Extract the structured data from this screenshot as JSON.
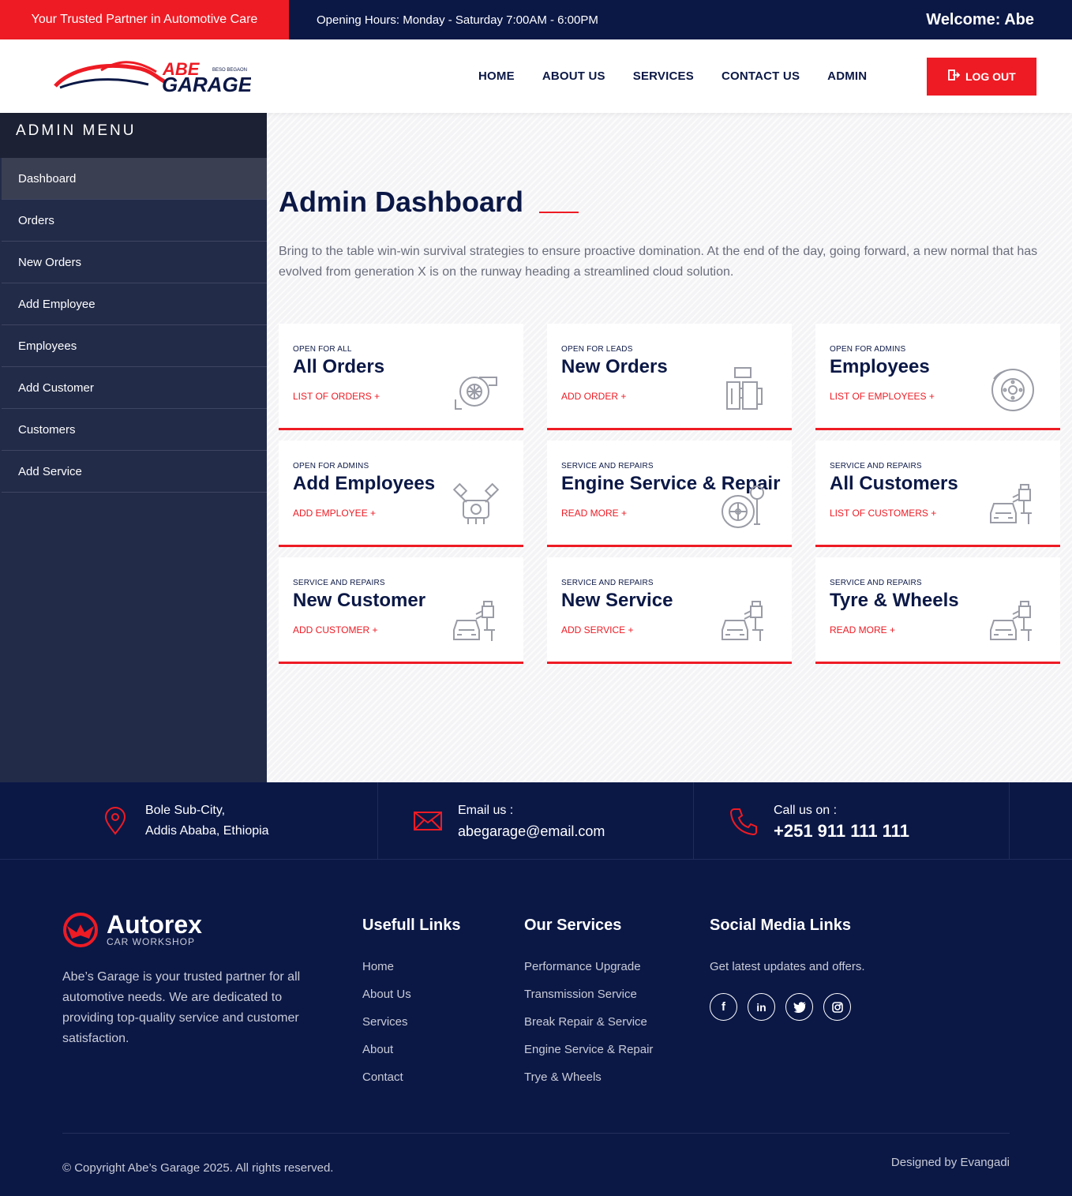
{
  "topbar": {
    "tagline": "Your Trusted Partner in Automotive Care",
    "hours": "Opening Hours: Monday - Saturday 7:00AM - 6:00PM",
    "welcome": "Welcome: Abe"
  },
  "header": {
    "logo_text_top": "ABE",
    "logo_text_bottom": "GARAGE",
    "logo_small": "BESO BEGAON",
    "nav": [
      "HOME",
      "ABOUT US",
      "SERVICES",
      "CONTACT US",
      "ADMIN"
    ],
    "logout_label": "LOG OUT"
  },
  "sidebar": {
    "title": "ADMIN MENU",
    "items": [
      "Dashboard",
      "Orders",
      "New Orders",
      "Add Employee",
      "Employees",
      "Add Customer",
      "Customers",
      "Add Service"
    ],
    "active_index": 0
  },
  "dashboard": {
    "title": "Admin Dashboard",
    "lead": "Bring to the table win-win survival strategies to ensure proactive domination. At the end of the day, going forward, a new normal that has evolved from generation X is on the runway heading a streamlined cloud solution.",
    "cards": [
      {
        "small": "Open for All",
        "heading": "All Orders",
        "link": "LIST OF ORDERS +",
        "icon": "turbo-icon"
      },
      {
        "small": "Open for leads",
        "heading": "New Orders",
        "link": "ADD ORDER +",
        "icon": "gearbox-icon"
      },
      {
        "small": "Open for admins",
        "heading": "Employees",
        "link": "LIST OF EMPLOYEES +",
        "icon": "brake-disc-icon"
      },
      {
        "small": "Open for admins",
        "heading": "Add Employees",
        "link": "ADD EMPLOYEE +",
        "icon": "engine-icon"
      },
      {
        "small": "Service and Repairs",
        "heading": "Engine Service & Repair",
        "link": "READ MORE +",
        "icon": "tyre-gauge-icon"
      },
      {
        "small": "Service and Repairs",
        "heading": "All Customers",
        "link": "LIST OF CUSTOMERS +",
        "icon": "car-paint-icon"
      },
      {
        "small": "Service and Repairs",
        "heading": "New Customer",
        "link": "ADD CUSTOMER +",
        "icon": "car-paint-icon"
      },
      {
        "small": "Service and Repairs",
        "heading": "New Service",
        "link": "ADD SERVICE +",
        "icon": "car-paint-icon"
      },
      {
        "small": "Service and Repairs",
        "heading": "Tyre & Wheels",
        "link": "READ MORE +",
        "icon": "car-paint-icon"
      }
    ]
  },
  "contact": {
    "address_line1": "Bole Sub-City,",
    "address_line2": "Addis Ababa, Ethiopia",
    "email_label": "Email us :",
    "email": "abegarage@email.com",
    "call_label": "Call us on :",
    "phone": "+251 911 111 111"
  },
  "footer": {
    "brand": "Autorex",
    "brand_sub": "CAR WORKSHOP",
    "about": "Abe’s Garage is your trusted partner for all automotive needs. We are dedicated to providing top-quality service and customer satisfaction.",
    "links_title": "Usefull Links",
    "links": [
      "Home",
      "About Us",
      "Services",
      "About",
      "Contact"
    ],
    "services_title": "Our Services",
    "services": [
      "Performance Upgrade",
      "Transmission Service",
      "Break Repair & Service",
      "Engine Service & Repair",
      "Trye & Wheels"
    ],
    "social_title": "Social Media Links",
    "social_note": "Get latest updates and offers.",
    "social_icons": [
      "facebook-icon",
      "linkedin-icon",
      "twitter-icon",
      "instagram-icon"
    ],
    "copyright": "© Copyright Abe’s Garage 2025. All rights reserved.",
    "designed_by": "Designed by Evangadi"
  },
  "colors": {
    "brand_red": "#ee1b24",
    "navy": "#0b1846",
    "sidebar": "#222b48"
  }
}
